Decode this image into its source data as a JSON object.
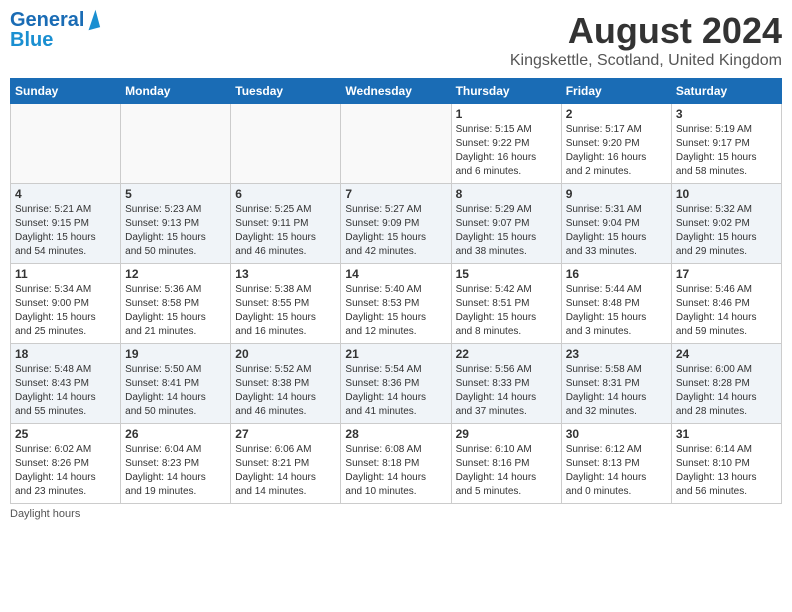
{
  "header": {
    "logo_line1": "General",
    "logo_line2": "Blue",
    "month_title": "August 2024",
    "location": "Kingskettle, Scotland, United Kingdom"
  },
  "weekdays": [
    "Sunday",
    "Monday",
    "Tuesday",
    "Wednesday",
    "Thursday",
    "Friday",
    "Saturday"
  ],
  "weeks": [
    [
      {
        "day": "",
        "info": ""
      },
      {
        "day": "",
        "info": ""
      },
      {
        "day": "",
        "info": ""
      },
      {
        "day": "",
        "info": ""
      },
      {
        "day": "1",
        "info": "Sunrise: 5:15 AM\nSunset: 9:22 PM\nDaylight: 16 hours\nand 6 minutes."
      },
      {
        "day": "2",
        "info": "Sunrise: 5:17 AM\nSunset: 9:20 PM\nDaylight: 16 hours\nand 2 minutes."
      },
      {
        "day": "3",
        "info": "Sunrise: 5:19 AM\nSunset: 9:17 PM\nDaylight: 15 hours\nand 58 minutes."
      }
    ],
    [
      {
        "day": "4",
        "info": "Sunrise: 5:21 AM\nSunset: 9:15 PM\nDaylight: 15 hours\nand 54 minutes."
      },
      {
        "day": "5",
        "info": "Sunrise: 5:23 AM\nSunset: 9:13 PM\nDaylight: 15 hours\nand 50 minutes."
      },
      {
        "day": "6",
        "info": "Sunrise: 5:25 AM\nSunset: 9:11 PM\nDaylight: 15 hours\nand 46 minutes."
      },
      {
        "day": "7",
        "info": "Sunrise: 5:27 AM\nSunset: 9:09 PM\nDaylight: 15 hours\nand 42 minutes."
      },
      {
        "day": "8",
        "info": "Sunrise: 5:29 AM\nSunset: 9:07 PM\nDaylight: 15 hours\nand 38 minutes."
      },
      {
        "day": "9",
        "info": "Sunrise: 5:31 AM\nSunset: 9:04 PM\nDaylight: 15 hours\nand 33 minutes."
      },
      {
        "day": "10",
        "info": "Sunrise: 5:32 AM\nSunset: 9:02 PM\nDaylight: 15 hours\nand 29 minutes."
      }
    ],
    [
      {
        "day": "11",
        "info": "Sunrise: 5:34 AM\nSunset: 9:00 PM\nDaylight: 15 hours\nand 25 minutes."
      },
      {
        "day": "12",
        "info": "Sunrise: 5:36 AM\nSunset: 8:58 PM\nDaylight: 15 hours\nand 21 minutes."
      },
      {
        "day": "13",
        "info": "Sunrise: 5:38 AM\nSunset: 8:55 PM\nDaylight: 15 hours\nand 16 minutes."
      },
      {
        "day": "14",
        "info": "Sunrise: 5:40 AM\nSunset: 8:53 PM\nDaylight: 15 hours\nand 12 minutes."
      },
      {
        "day": "15",
        "info": "Sunrise: 5:42 AM\nSunset: 8:51 PM\nDaylight: 15 hours\nand 8 minutes."
      },
      {
        "day": "16",
        "info": "Sunrise: 5:44 AM\nSunset: 8:48 PM\nDaylight: 15 hours\nand 3 minutes."
      },
      {
        "day": "17",
        "info": "Sunrise: 5:46 AM\nSunset: 8:46 PM\nDaylight: 14 hours\nand 59 minutes."
      }
    ],
    [
      {
        "day": "18",
        "info": "Sunrise: 5:48 AM\nSunset: 8:43 PM\nDaylight: 14 hours\nand 55 minutes."
      },
      {
        "day": "19",
        "info": "Sunrise: 5:50 AM\nSunset: 8:41 PM\nDaylight: 14 hours\nand 50 minutes."
      },
      {
        "day": "20",
        "info": "Sunrise: 5:52 AM\nSunset: 8:38 PM\nDaylight: 14 hours\nand 46 minutes."
      },
      {
        "day": "21",
        "info": "Sunrise: 5:54 AM\nSunset: 8:36 PM\nDaylight: 14 hours\nand 41 minutes."
      },
      {
        "day": "22",
        "info": "Sunrise: 5:56 AM\nSunset: 8:33 PM\nDaylight: 14 hours\nand 37 minutes."
      },
      {
        "day": "23",
        "info": "Sunrise: 5:58 AM\nSunset: 8:31 PM\nDaylight: 14 hours\nand 32 minutes."
      },
      {
        "day": "24",
        "info": "Sunrise: 6:00 AM\nSunset: 8:28 PM\nDaylight: 14 hours\nand 28 minutes."
      }
    ],
    [
      {
        "day": "25",
        "info": "Sunrise: 6:02 AM\nSunset: 8:26 PM\nDaylight: 14 hours\nand 23 minutes."
      },
      {
        "day": "26",
        "info": "Sunrise: 6:04 AM\nSunset: 8:23 PM\nDaylight: 14 hours\nand 19 minutes."
      },
      {
        "day": "27",
        "info": "Sunrise: 6:06 AM\nSunset: 8:21 PM\nDaylight: 14 hours\nand 14 minutes."
      },
      {
        "day": "28",
        "info": "Sunrise: 6:08 AM\nSunset: 8:18 PM\nDaylight: 14 hours\nand 10 minutes."
      },
      {
        "day": "29",
        "info": "Sunrise: 6:10 AM\nSunset: 8:16 PM\nDaylight: 14 hours\nand 5 minutes."
      },
      {
        "day": "30",
        "info": "Sunrise: 6:12 AM\nSunset: 8:13 PM\nDaylight: 14 hours\nand 0 minutes."
      },
      {
        "day": "31",
        "info": "Sunrise: 6:14 AM\nSunset: 8:10 PM\nDaylight: 13 hours\nand 56 minutes."
      }
    ]
  ],
  "footer": {
    "daylight_label": "Daylight hours"
  }
}
